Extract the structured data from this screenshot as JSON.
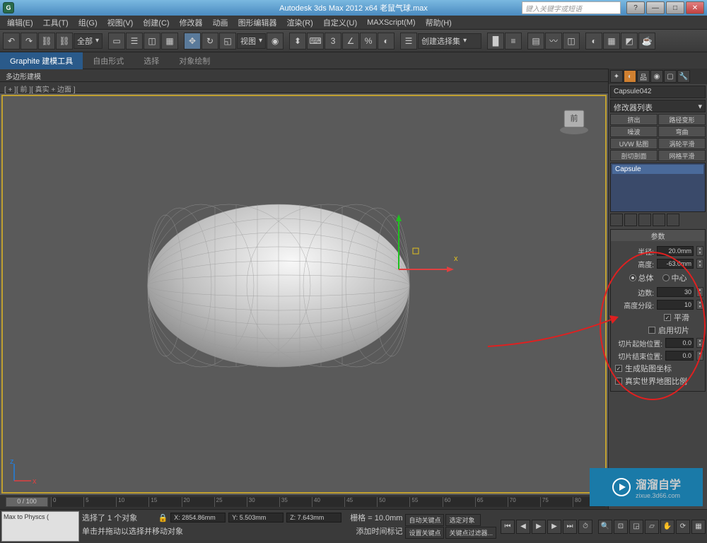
{
  "title": "Autodesk 3ds Max  2012 x64     老鼠气球.max",
  "search_placeholder": "键入关键字或短语",
  "menu": [
    "编辑(E)",
    "工具(T)",
    "组(G)",
    "视图(V)",
    "创建(C)",
    "修改器",
    "动画",
    "图形编辑器",
    "渲染(R)",
    "自定义(U)",
    "MAXScript(M)",
    "帮助(H)"
  ],
  "toolbar_dd1": "全部",
  "toolbar_dd2": "视图",
  "toolbar_dd3": "创建选择集",
  "ribbon": {
    "tab1": "Graphite 建模工具",
    "tab2": "自由形式",
    "tab3": "选择",
    "tab4": "对象绘制",
    "sub": "多边形建模"
  },
  "viewport_label": "[ + ][ 前 ][ 真实 + 边面 ]",
  "panel": {
    "object_name": "Capsule042",
    "modifier_dd": "修改器列表",
    "mods": [
      "挤出",
      "路径变形",
      "噪波",
      "弯曲",
      "UVW 贴图",
      "涡轮平滑",
      "剖切剖面",
      "网格平滑"
    ],
    "stack_item": "Capsule",
    "rollout_title": "参数",
    "radius_label": "半径:",
    "radius_val": "20.0mm",
    "height_label": "高度:",
    "height_val": "-63.0mm",
    "overall": "总体",
    "center": "中心",
    "sides_label": "边数:",
    "sides_val": "30",
    "hseg_label": "高度分段:",
    "hseg_val": "10",
    "smooth": "平滑",
    "enable_slice": "启用切片",
    "slice_from_label": "切片起始位置:",
    "slice_from_val": "0.0",
    "slice_to_label": "切片结束位置:",
    "slice_to_val": "0.0",
    "gen_uv": "生成贴图坐标",
    "real_world": "真实世界地图比例"
  },
  "timeline_pos": "0 / 100",
  "status": {
    "script": "Max to Physcs (",
    "sel": "选择了 1 个对象",
    "hint": "单击并拖动以选择并移动对象",
    "x": "X: 2854.86mm",
    "y": "Y: 5.503mm",
    "z": "Z: 7.643mm",
    "grid": "栅格 = 10.0mm",
    "autokey": "自动关键点",
    "selset": "选定对象",
    "addtime": "添加时间标记",
    "setkey": "设置关键点",
    "keyfilter": "关键点过滤器..."
  },
  "watermark": "溜溜自学",
  "watermark_url": "zixue.3d66.com"
}
